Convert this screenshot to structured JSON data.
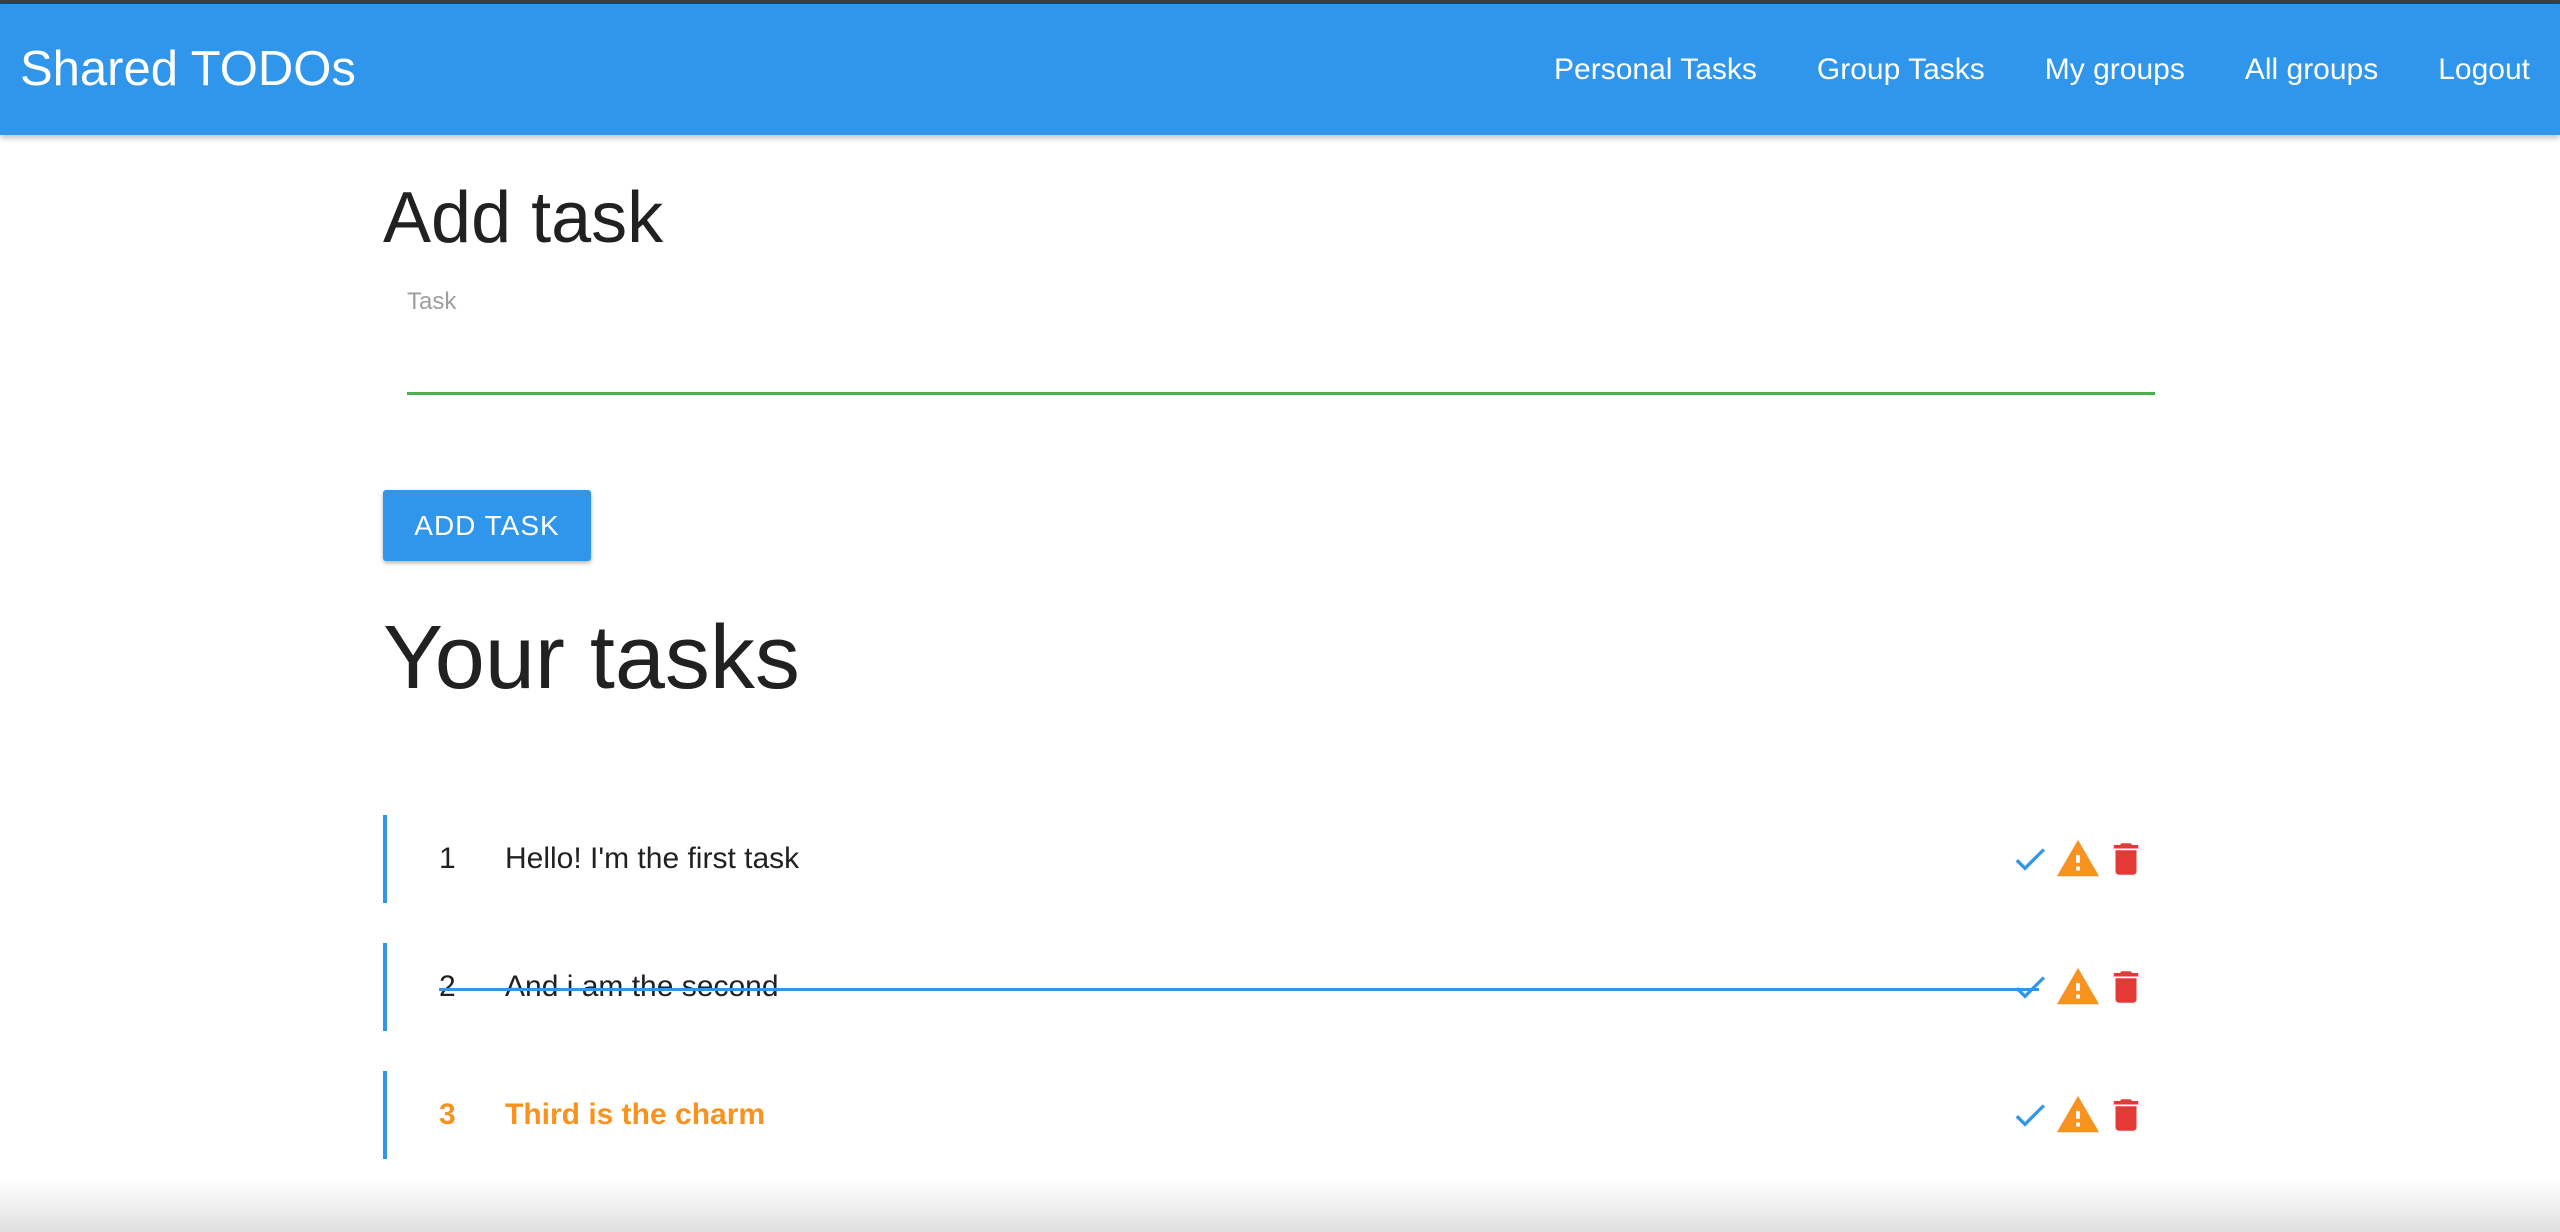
{
  "app": {
    "brand": "Shared TODOs"
  },
  "nav": {
    "items": [
      {
        "label": "Personal Tasks"
      },
      {
        "label": "Group Tasks"
      },
      {
        "label": "My groups"
      },
      {
        "label": "All groups"
      },
      {
        "label": "Logout"
      }
    ]
  },
  "add_form": {
    "title": "Add task",
    "field_label": "Task",
    "value": "",
    "button_label": "ADD TASK"
  },
  "tasks": {
    "title": "Your tasks",
    "items": [
      {
        "number": "1",
        "text": "Hello! I'm the first task",
        "done": false,
        "important": false
      },
      {
        "number": "2",
        "text": "And i am the second",
        "done": true,
        "important": false
      },
      {
        "number": "3",
        "text": "Third is the charm",
        "done": false,
        "important": true
      }
    ]
  },
  "icons": {
    "done": "check-icon",
    "important": "warning-icon",
    "delete": "trash-icon"
  },
  "colors": {
    "primary": "#2f96ec",
    "important": "#f7931e",
    "delete": "#e53935",
    "input_underline": "#4caf50"
  }
}
